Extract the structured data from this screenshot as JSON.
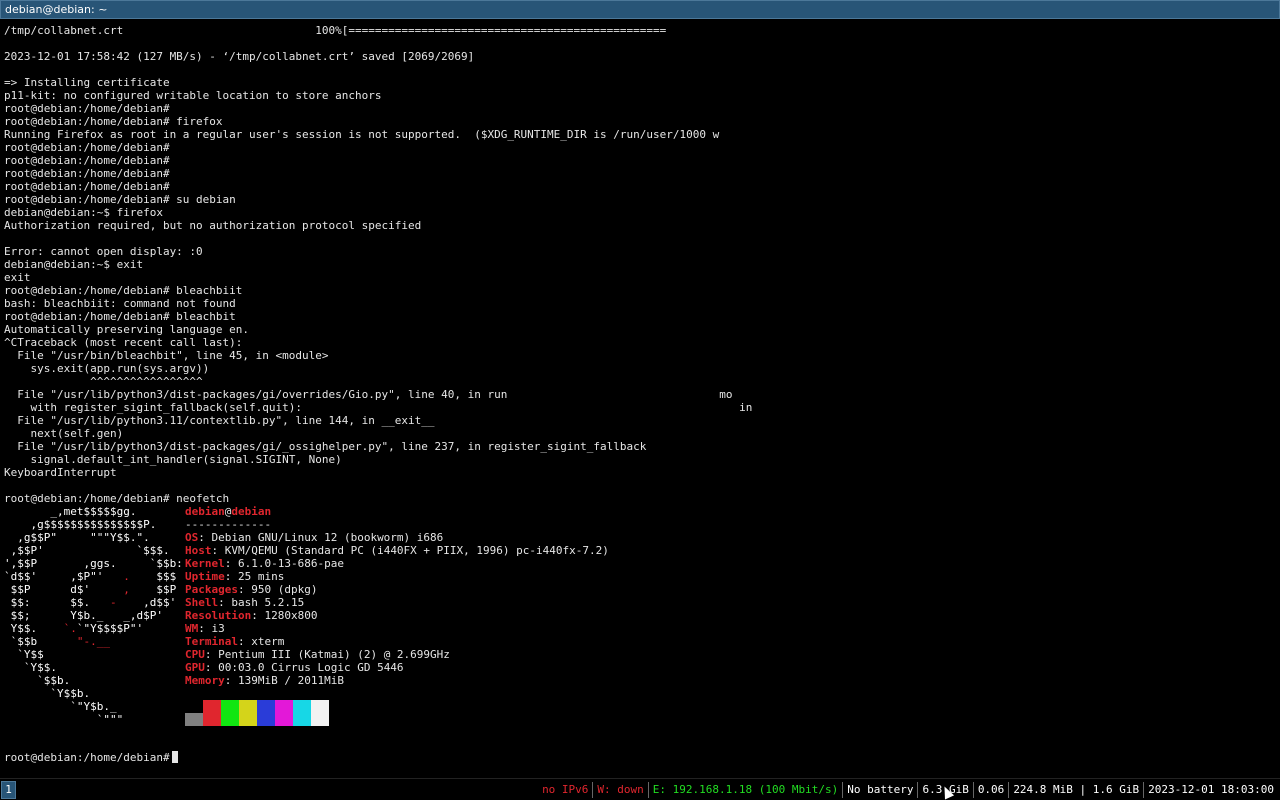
{
  "window": {
    "title": "debian@debian: ~"
  },
  "terminal": {
    "lines": [
      "/tmp/collabnet.crt                             100%[================================================",
      "",
      "2023-12-01 17:58:42 (127 MB/s) - ‘/tmp/collabnet.crt’ saved [2069/2069]",
      "",
      "=> Installing certificate",
      "p11-kit: no configured writable location to store anchors",
      "root@debian:/home/debian#",
      "root@debian:/home/debian# firefox",
      "Running Firefox as root in a regular user's session is not supported.  ($XDG_RUNTIME_DIR is /run/user/1000 w",
      "root@debian:/home/debian#",
      "root@debian:/home/debian#",
      "root@debian:/home/debian#",
      "root@debian:/home/debian#",
      "root@debian:/home/debian# su debian",
      "debian@debian:~$ firefox",
      "Authorization required, but no authorization protocol specified",
      "",
      "Error: cannot open display: :0",
      "debian@debian:~$ exit",
      "exit",
      "root@debian:/home/debian# bleachbiit",
      "bash: bleachbiit: command not found",
      "root@debian:/home/debian# bleachbit",
      "Automatically preserving language en.",
      "^CTraceback (most recent call last):",
      "  File \"/usr/bin/bleachbit\", line 45, in <module>",
      "    sys.exit(app.run(sys.argv))",
      "             ^^^^^^^^^^^^^^^^^",
      "  File \"/usr/lib/python3/dist-packages/gi/overrides/Gio.py\", line 40, in run                                mo",
      "    with register_sigint_fallback(self.quit):                                                                  in",
      "  File \"/usr/lib/python3.11/contextlib.py\", line 144, in __exit__",
      "    next(self.gen)",
      "  File \"/usr/lib/python3/dist-packages/gi/_ossighelper.py\", line 237, in register_sigint_fallback",
      "    signal.default_int_handler(signal.SIGINT, None)",
      "KeyboardInterrupt",
      "",
      "root@debian:/home/debian# neofetch"
    ],
    "prompt": "root@debian:/home/debian#"
  },
  "neofetch": {
    "user": "debian",
    "at": "@",
    "host": "debian",
    "separator": "-------------",
    "info": [
      {
        "key": "OS",
        "value": "Debian GNU/Linux 12 (bookworm) i686"
      },
      {
        "key": "Host",
        "value": "KVM/QEMU (Standard PC (i440FX + PIIX, 1996) pc-i440fx-7.2)"
      },
      {
        "key": "Kernel",
        "value": "6.1.0-13-686-pae"
      },
      {
        "key": "Uptime",
        "value": "25 mins"
      },
      {
        "key": "Packages",
        "value": "950 (dpkg)"
      },
      {
        "key": "Shell",
        "value": "bash 5.2.15"
      },
      {
        "key": "Resolution",
        "value": "1280x800"
      },
      {
        "key": "WM",
        "value": "i3"
      },
      {
        "key": "Terminal",
        "value": "xterm"
      },
      {
        "key": "CPU",
        "value": "Pentium III (Katmai) (2) @ 2.699GHz"
      },
      {
        "key": "GPU",
        "value": "00:03.0 Cirrus Logic GD 5446"
      },
      {
        "key": "Memory",
        "value": "139MiB / 2011MiB"
      }
    ],
    "palette": [
      "#808080",
      "#e0262e",
      "#11e611",
      "#d4d41a",
      "#2a3cd8",
      "#e318d8",
      "#17d7e6",
      "#f2f2f2"
    ]
  },
  "statusbar": {
    "workspace": "1",
    "blocks": [
      {
        "text": "no IPv6",
        "color": "#e0262e"
      },
      {
        "text": "W: down",
        "color": "#e0262e"
      },
      {
        "text": "E: 192.168.1.18 (100 Mbit/s)",
        "color": "#22dd22"
      },
      {
        "text": "No battery",
        "color": "#ffffff"
      },
      {
        "text": "6.3 GiB",
        "color": "#ffffff"
      },
      {
        "text": "0.06",
        "color": "#ffffff"
      },
      {
        "text": "224.8 MiB | 1.6 GiB",
        "color": "#ffffff"
      },
      {
        "text": "2023-12-01 18:03:00",
        "color": "#ffffff"
      }
    ]
  }
}
